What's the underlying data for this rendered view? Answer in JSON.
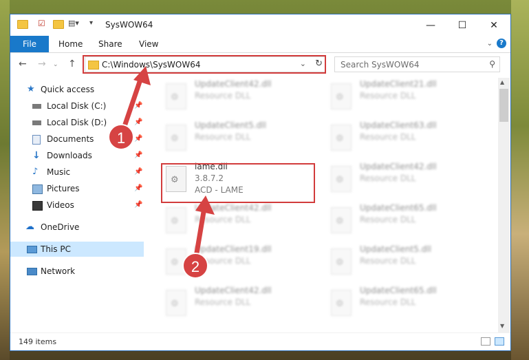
{
  "window": {
    "title": "SysWOW64",
    "minimize": "—",
    "maximize": "☐",
    "close": "✕"
  },
  "ribbon": {
    "file": "File",
    "home": "Home",
    "share": "Share",
    "view": "View",
    "help": "?"
  },
  "address": {
    "path": "C:\\Windows\\SysWOW64",
    "search_placeholder": "Search SysWOW64"
  },
  "nav": [
    {
      "label": "Quick access",
      "icon": "star-icon"
    },
    {
      "label": "Local Disk (C:)",
      "icon": "drive-icon",
      "pinned": true
    },
    {
      "label": "Local Disk (D:)",
      "icon": "drive-icon",
      "pinned": true
    },
    {
      "label": "Documents",
      "icon": "documents-icon",
      "pinned": true
    },
    {
      "label": "Downloads",
      "icon": "download-icon",
      "pinned": true
    },
    {
      "label": "Music",
      "icon": "music-icon",
      "pinned": true
    },
    {
      "label": "Pictures",
      "icon": "pictures-icon",
      "pinned": true
    },
    {
      "label": "Videos",
      "icon": "videos-icon",
      "pinned": true
    },
    {
      "label": "OneDrive",
      "icon": "cloud-icon"
    },
    {
      "label": "This PC",
      "icon": "computer-icon"
    },
    {
      "label": "Network",
      "icon": "network-icon"
    }
  ],
  "files_left": [
    {
      "name": "UpdateClient42.dll",
      "type": "Resource DLL"
    },
    {
      "name": "UpdateClient5.dll",
      "type": "Resource DLL"
    },
    {
      "name": "lame.dll",
      "version": "3.8.7.2",
      "company": "ACD - LAME"
    },
    {
      "name": "UpdateClient42.dll",
      "type": "Resource DLL"
    },
    {
      "name": "UpdateClient19.dll",
      "type": "Resource DLL"
    },
    {
      "name": "UpdateClient42.dll",
      "type": "Resource DLL"
    }
  ],
  "files_right": [
    {
      "name": "UpdateClient21.dll",
      "type": "Resource DLL"
    },
    {
      "name": "UpdateClient63.dll",
      "type": "Resource DLL"
    },
    {
      "name": "UpdateClient42.dll",
      "type": "Resource DLL"
    },
    {
      "name": "UpdateClient65.dll",
      "type": "Resource DLL"
    },
    {
      "name": "UpdateClient5.dll",
      "type": "Resource DLL"
    },
    {
      "name": "UpdateClient65.dll",
      "type": "Resource DLL"
    }
  ],
  "status": {
    "item_count": "149 items"
  },
  "annotations": {
    "step1": "1",
    "step2": "2",
    "color": "#d64343"
  },
  "colors": {
    "accent": "#1979ca",
    "highlight": "#d23b3b",
    "selected_nav": "#cce8ff"
  }
}
